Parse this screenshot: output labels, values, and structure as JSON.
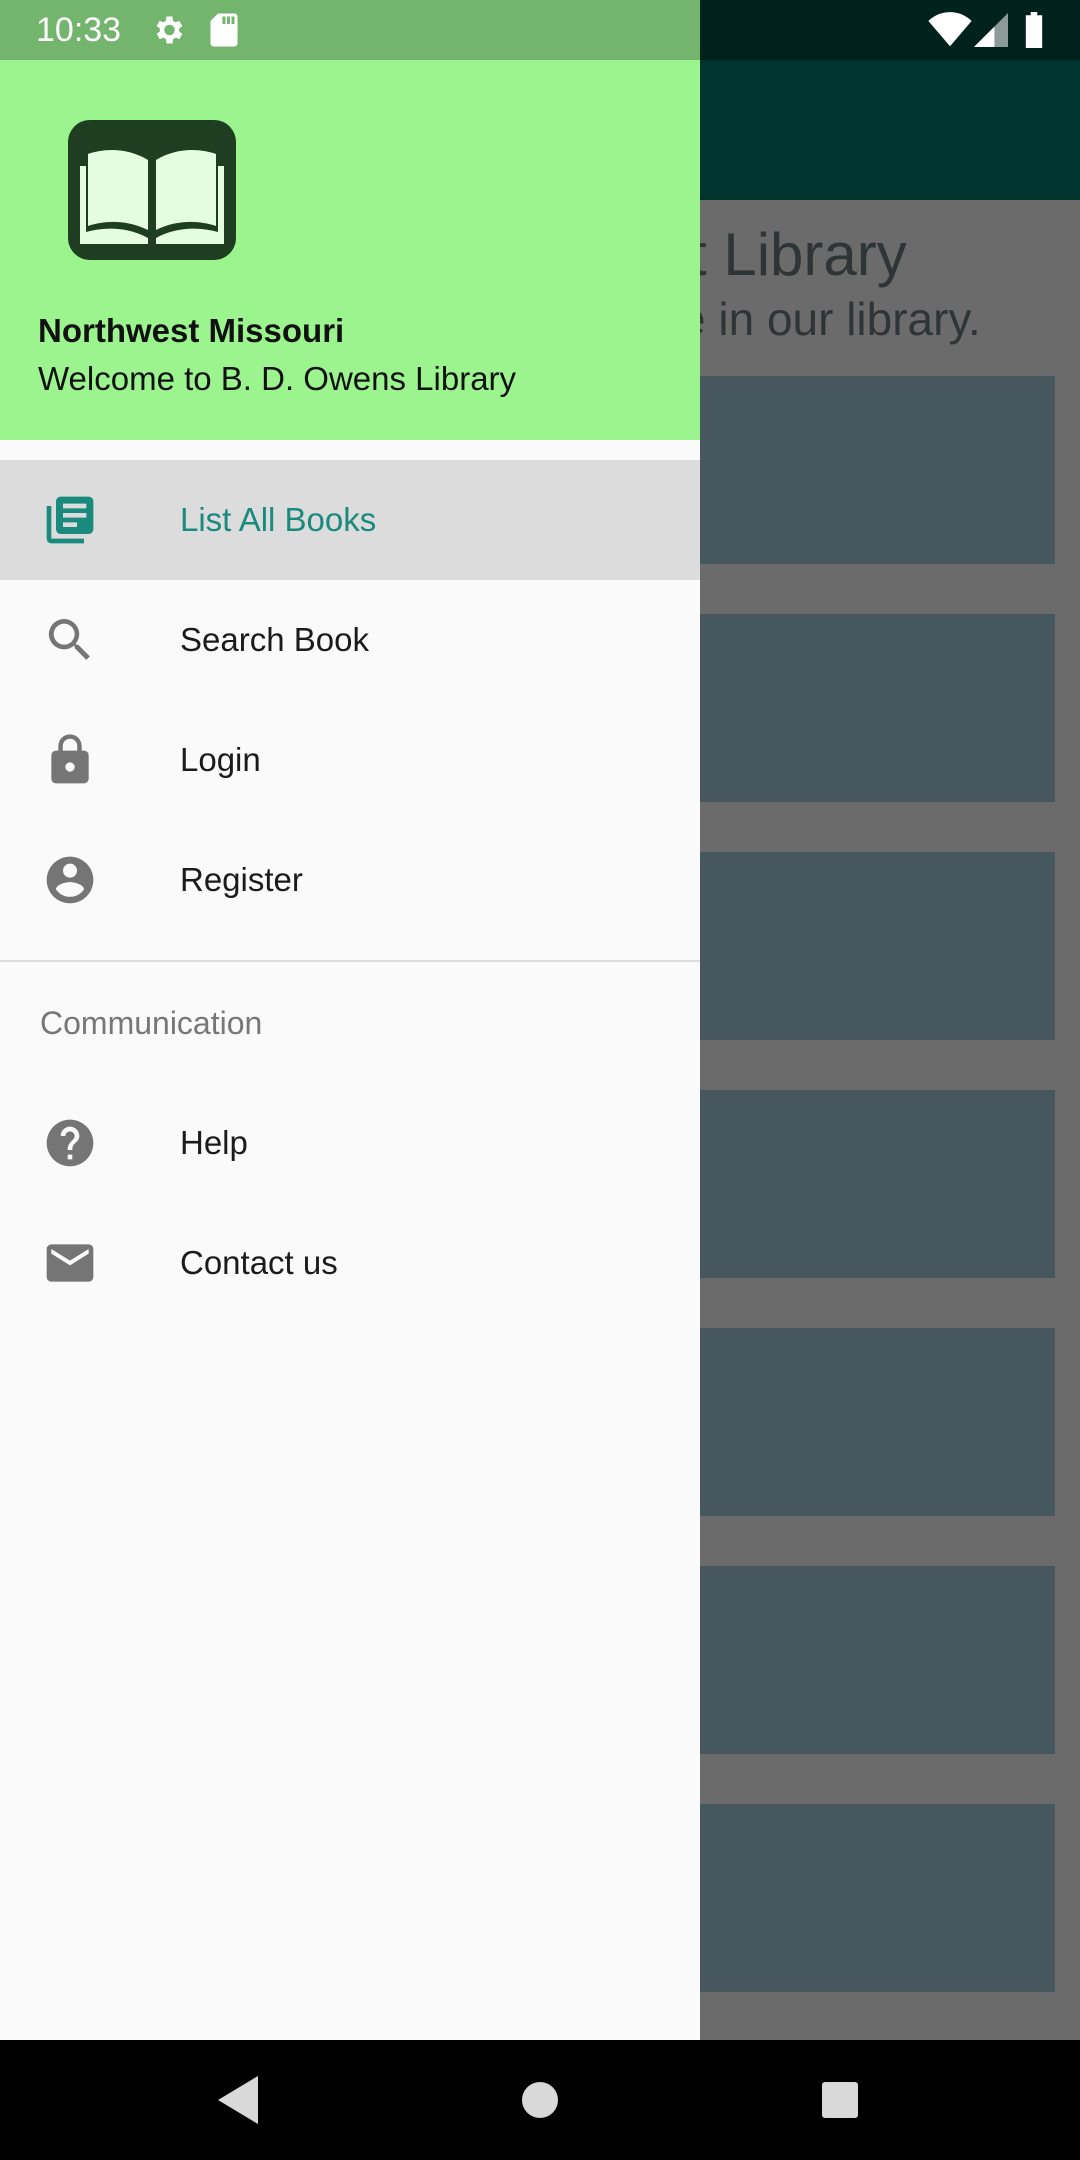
{
  "status_bar": {
    "time": "10:33"
  },
  "background_app": {
    "title": "st Library",
    "subtitle": "e in our library."
  },
  "drawer": {
    "header": {
      "title": "Northwest Missouri",
      "subtitle": "Welcome to B. D. Owens Library"
    },
    "main_items": [
      {
        "label": "List All Books",
        "icon": "list-books-icon",
        "selected": true
      },
      {
        "label": "Search Book",
        "icon": "search-icon",
        "selected": false
      },
      {
        "label": "Login",
        "icon": "lock-icon",
        "selected": false
      },
      {
        "label": "Register",
        "icon": "account-icon",
        "selected": false
      }
    ],
    "section_title": "Communication",
    "section_items": [
      {
        "label": "Help",
        "icon": "help-icon"
      },
      {
        "label": "Contact us",
        "icon": "mail-icon"
      }
    ]
  },
  "colors": {
    "header_bg": "#9cf48f",
    "accent": "#1a8a7e",
    "status_bar_left": "#74b56e",
    "toolbar": "#00342e"
  }
}
